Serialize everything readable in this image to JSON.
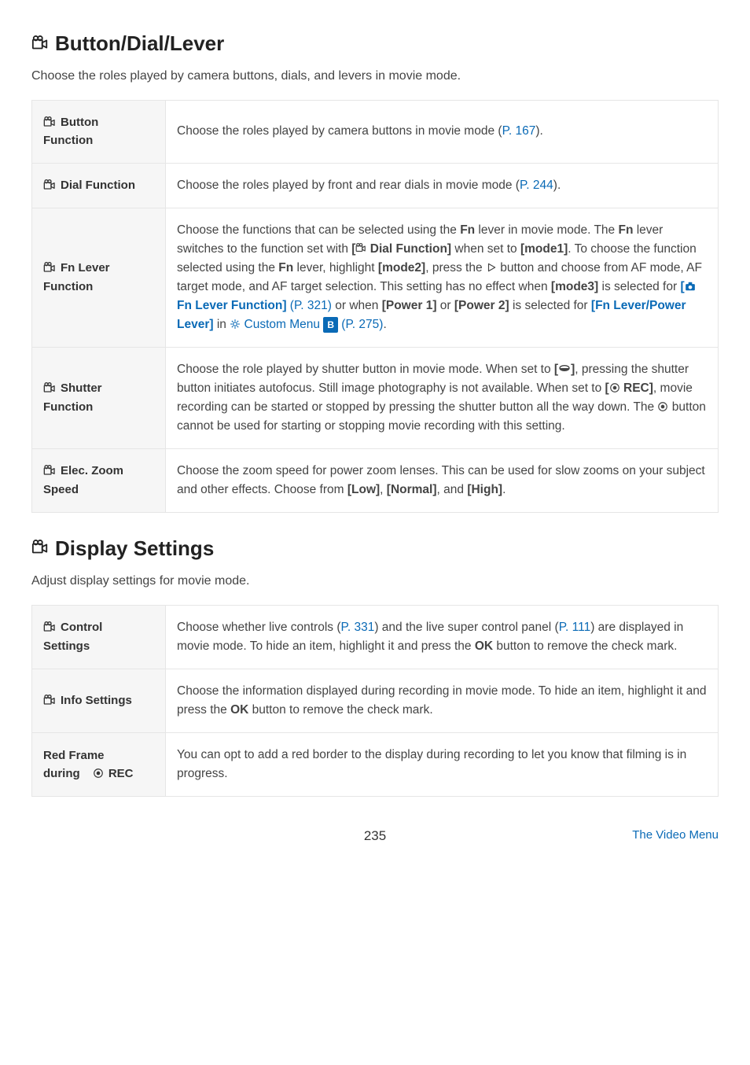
{
  "section1": {
    "title": "Button/Dial/Lever",
    "intro": "Choose the roles played by camera buttons, dials, and levers in movie mode.",
    "rows": {
      "button_function": {
        "label1": "Button",
        "label2": "Function",
        "desc_a": "Choose the roles played by camera buttons in movie mode (",
        "ref": "P. 167",
        "desc_b": ")."
      },
      "dial_function": {
        "label": "Dial Function",
        "desc_a": "Choose the roles played by front and rear dials in movie mode (",
        "ref": "P. 244",
        "desc_b": ")."
      },
      "fn_lever": {
        "label1": "Fn Lever",
        "label2": "Function",
        "p1_a": "Choose the functions that can be selected using the ",
        "p1_fn": "Fn",
        "p1_b": " lever in movie mode. The ",
        "p1_fn2": "Fn",
        "p1_c": " lever switches to the function set with ",
        "p1_bracket_open": "[",
        "p1_dialfn": " Dial Function]",
        "p1_d": " when set to ",
        "p1_mode1": "[mode1]",
        "p1_e": ". To choose the function selected using the ",
        "p1_fn3": "Fn",
        "p1_f": " lever, highlight ",
        "p1_mode2": "[mode2]",
        "p1_g": ", press the ",
        "p1_h": " button and choose from AF mode, AF target mode, and AF target selection. This setting has no effect when ",
        "p1_mode3": "[mode3]",
        "p1_i": " is selected for ",
        "p1_link_open": "[",
        "p1_link_label": " Fn Lever Function]",
        "p1_link_ref": " (P. 321)",
        "p1_j": " or when ",
        "p1_pow1": "[Power 1]",
        "p1_k": " or ",
        "p1_pow2": "[Power 2]",
        "p1_l": " is selected for ",
        "p1_levpow": "[Fn Lever/Power Lever]",
        "p1_m": " in ",
        "p1_custom": " Custom Menu ",
        "p1_badge": "B",
        "p1_ref2": " (P. 275)",
        "p1_n": "."
      },
      "shutter": {
        "label1": "Shutter",
        "label2": "Function",
        "a": "Choose the role played by shutter button in movie mode. When set to ",
        "bracket_open": "[",
        "bracket_close": "]",
        "b": ", pressing the shutter button initiates autofocus. Still image photography is not available. When set to ",
        "rec_open": "[",
        "rec_label": " REC]",
        "c": ", movie recording can be started or stopped by pressing the shutter button all the way down. The ",
        "d": " button cannot be used for starting or stopping movie recording with this setting."
      },
      "eleczoom": {
        "label1": "Elec. Zoom",
        "label2": "Speed",
        "a": "Choose the zoom speed for power zoom lenses. This can be used for slow zooms on your subject and other effects. Choose from ",
        "low": "[Low]",
        "sep1": ", ",
        "normal": "[Normal]",
        "sep2": ", and ",
        "high": "[High]",
        "end": "."
      }
    }
  },
  "section2": {
    "title": "Display Settings",
    "intro": "Adjust display settings for movie mode.",
    "rows": {
      "control": {
        "label1": "Control",
        "label2": "Settings",
        "a": "Choose whether live controls (",
        "ref1": "P. 331",
        "b": ") and the live super control panel (",
        "ref2": "P. 111",
        "c": ") are displayed in movie mode. To hide an item, highlight it and press the ",
        "ok": "OK",
        "d": " button to remove the check mark."
      },
      "info": {
        "label": "Info Settings",
        "a": "Choose the information displayed during recording in movie mode. To hide an item, highlight it and press the ",
        "ok": "OK",
        "b": " button to remove the check mark."
      },
      "redframe": {
        "label1": "Red Frame",
        "label2_a": "during ",
        "label2_b": "REC",
        "a": "You can opt to add a red border to the display during recording to let you know that filming is in progress."
      }
    }
  },
  "footer": {
    "page": "235",
    "crumb": "The Video Menu"
  }
}
